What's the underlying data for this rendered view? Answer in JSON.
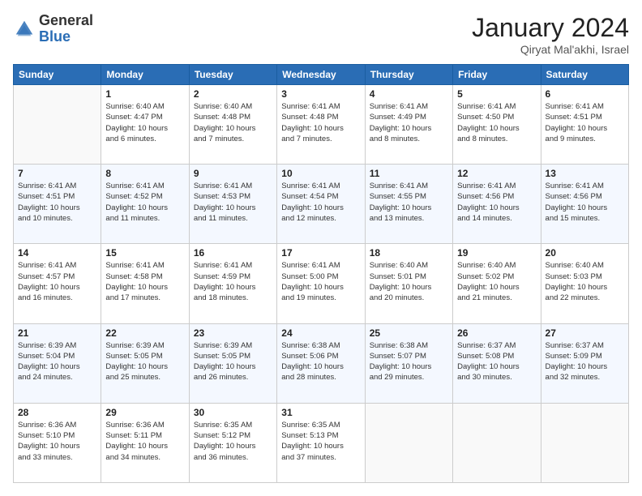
{
  "header": {
    "logo_general": "General",
    "logo_blue": "Blue",
    "month_title": "January 2024",
    "location": "Qiryat Mal'akhi, Israel"
  },
  "days_of_week": [
    "Sunday",
    "Monday",
    "Tuesday",
    "Wednesday",
    "Thursday",
    "Friday",
    "Saturday"
  ],
  "weeks": [
    [
      {
        "day": "",
        "info": ""
      },
      {
        "day": "1",
        "info": "Sunrise: 6:40 AM\nSunset: 4:47 PM\nDaylight: 10 hours\nand 6 minutes."
      },
      {
        "day": "2",
        "info": "Sunrise: 6:40 AM\nSunset: 4:48 PM\nDaylight: 10 hours\nand 7 minutes."
      },
      {
        "day": "3",
        "info": "Sunrise: 6:41 AM\nSunset: 4:48 PM\nDaylight: 10 hours\nand 7 minutes."
      },
      {
        "day": "4",
        "info": "Sunrise: 6:41 AM\nSunset: 4:49 PM\nDaylight: 10 hours\nand 8 minutes."
      },
      {
        "day": "5",
        "info": "Sunrise: 6:41 AM\nSunset: 4:50 PM\nDaylight: 10 hours\nand 8 minutes."
      },
      {
        "day": "6",
        "info": "Sunrise: 6:41 AM\nSunset: 4:51 PM\nDaylight: 10 hours\nand 9 minutes."
      }
    ],
    [
      {
        "day": "7",
        "info": "Sunrise: 6:41 AM\nSunset: 4:51 PM\nDaylight: 10 hours\nand 10 minutes."
      },
      {
        "day": "8",
        "info": "Sunrise: 6:41 AM\nSunset: 4:52 PM\nDaylight: 10 hours\nand 11 minutes."
      },
      {
        "day": "9",
        "info": "Sunrise: 6:41 AM\nSunset: 4:53 PM\nDaylight: 10 hours\nand 11 minutes."
      },
      {
        "day": "10",
        "info": "Sunrise: 6:41 AM\nSunset: 4:54 PM\nDaylight: 10 hours\nand 12 minutes."
      },
      {
        "day": "11",
        "info": "Sunrise: 6:41 AM\nSunset: 4:55 PM\nDaylight: 10 hours\nand 13 minutes."
      },
      {
        "day": "12",
        "info": "Sunrise: 6:41 AM\nSunset: 4:56 PM\nDaylight: 10 hours\nand 14 minutes."
      },
      {
        "day": "13",
        "info": "Sunrise: 6:41 AM\nSunset: 4:56 PM\nDaylight: 10 hours\nand 15 minutes."
      }
    ],
    [
      {
        "day": "14",
        "info": "Sunrise: 6:41 AM\nSunset: 4:57 PM\nDaylight: 10 hours\nand 16 minutes."
      },
      {
        "day": "15",
        "info": "Sunrise: 6:41 AM\nSunset: 4:58 PM\nDaylight: 10 hours\nand 17 minutes."
      },
      {
        "day": "16",
        "info": "Sunrise: 6:41 AM\nSunset: 4:59 PM\nDaylight: 10 hours\nand 18 minutes."
      },
      {
        "day": "17",
        "info": "Sunrise: 6:41 AM\nSunset: 5:00 PM\nDaylight: 10 hours\nand 19 minutes."
      },
      {
        "day": "18",
        "info": "Sunrise: 6:40 AM\nSunset: 5:01 PM\nDaylight: 10 hours\nand 20 minutes."
      },
      {
        "day": "19",
        "info": "Sunrise: 6:40 AM\nSunset: 5:02 PM\nDaylight: 10 hours\nand 21 minutes."
      },
      {
        "day": "20",
        "info": "Sunrise: 6:40 AM\nSunset: 5:03 PM\nDaylight: 10 hours\nand 22 minutes."
      }
    ],
    [
      {
        "day": "21",
        "info": "Sunrise: 6:39 AM\nSunset: 5:04 PM\nDaylight: 10 hours\nand 24 minutes."
      },
      {
        "day": "22",
        "info": "Sunrise: 6:39 AM\nSunset: 5:05 PM\nDaylight: 10 hours\nand 25 minutes."
      },
      {
        "day": "23",
        "info": "Sunrise: 6:39 AM\nSunset: 5:05 PM\nDaylight: 10 hours\nand 26 minutes."
      },
      {
        "day": "24",
        "info": "Sunrise: 6:38 AM\nSunset: 5:06 PM\nDaylight: 10 hours\nand 28 minutes."
      },
      {
        "day": "25",
        "info": "Sunrise: 6:38 AM\nSunset: 5:07 PM\nDaylight: 10 hours\nand 29 minutes."
      },
      {
        "day": "26",
        "info": "Sunrise: 6:37 AM\nSunset: 5:08 PM\nDaylight: 10 hours\nand 30 minutes."
      },
      {
        "day": "27",
        "info": "Sunrise: 6:37 AM\nSunset: 5:09 PM\nDaylight: 10 hours\nand 32 minutes."
      }
    ],
    [
      {
        "day": "28",
        "info": "Sunrise: 6:36 AM\nSunset: 5:10 PM\nDaylight: 10 hours\nand 33 minutes."
      },
      {
        "day": "29",
        "info": "Sunrise: 6:36 AM\nSunset: 5:11 PM\nDaylight: 10 hours\nand 34 minutes."
      },
      {
        "day": "30",
        "info": "Sunrise: 6:35 AM\nSunset: 5:12 PM\nDaylight: 10 hours\nand 36 minutes."
      },
      {
        "day": "31",
        "info": "Sunrise: 6:35 AM\nSunset: 5:13 PM\nDaylight: 10 hours\nand 37 minutes."
      },
      {
        "day": "",
        "info": ""
      },
      {
        "day": "",
        "info": ""
      },
      {
        "day": "",
        "info": ""
      }
    ]
  ]
}
